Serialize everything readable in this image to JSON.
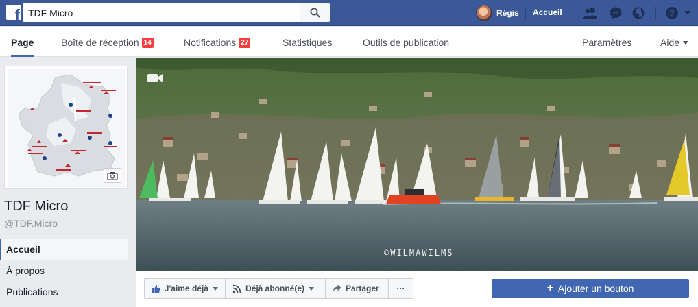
{
  "topbar": {
    "search": {
      "value": "TDF Micro",
      "placeholder": ""
    },
    "profile_name": "Régis",
    "home_label": "Accueil",
    "icons": [
      "friend-requests-icon",
      "messenger-icon",
      "notifications-globe-icon",
      "help-icon",
      "account-menu-icon"
    ]
  },
  "pagenav": {
    "tabs": [
      {
        "label": "Page",
        "active": true
      },
      {
        "label": "Boîte de réception",
        "badge": "14"
      },
      {
        "label": "Notifications",
        "badge": "27"
      },
      {
        "label": "Statistiques"
      },
      {
        "label": "Outils de publication"
      }
    ],
    "settings_label": "Paramètres",
    "help_label": "Aide"
  },
  "page": {
    "name": "TDF Micro",
    "handle": "@TDF.Micro"
  },
  "leftnav": {
    "items": [
      {
        "label": "Accueil",
        "active": true
      },
      {
        "label": "À propos"
      },
      {
        "label": "Publications"
      }
    ]
  },
  "cover": {
    "watermark": "©WILMAWILMS"
  },
  "actions": {
    "like_label": "J'aime déjà",
    "follow_label": "Déjà abonné(e)",
    "share_label": "Partager",
    "more_label": "···",
    "add_button_label": "Ajouter un bouton"
  },
  "colors": {
    "topbar": "#3b5998",
    "accent": "#4267b2",
    "badge": "#fa3e3e"
  }
}
